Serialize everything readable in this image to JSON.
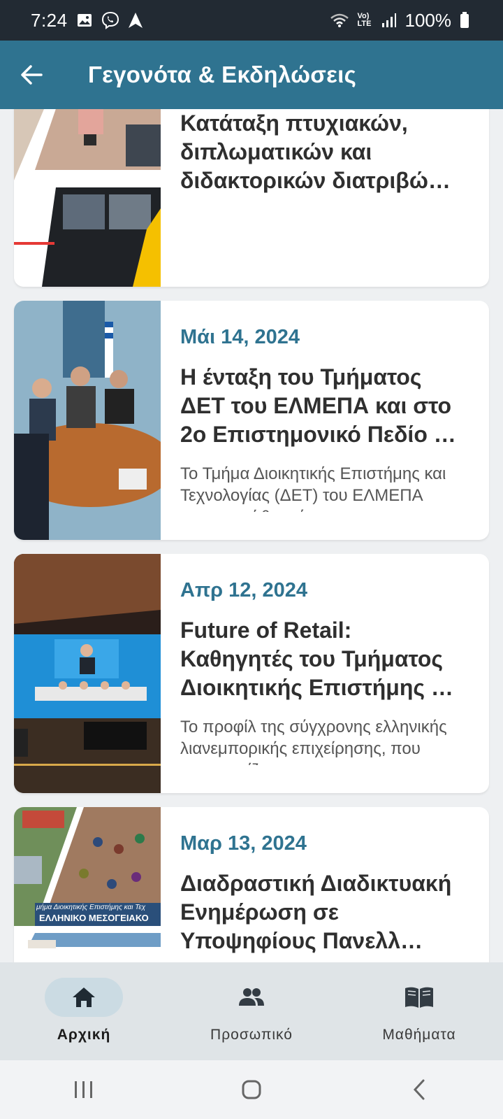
{
  "status_bar": {
    "time": "7:24",
    "battery": "100%",
    "network_label": "Vo) LTE",
    "icons": [
      "image-icon",
      "viber-icon",
      "navigation-icon",
      "wifi-icon",
      "lte-icon",
      "signal-icon",
      "battery-icon"
    ]
  },
  "app_bar": {
    "title": "Γεγονότα & Εκδηλώσεις",
    "back_icon": "arrow-back-icon"
  },
  "news": [
    {
      "date": "",
      "title": "Κατάταξη πτυχιακών, διπλωματικών και διδακτορικών διατριβώ…",
      "excerpt": ""
    },
    {
      "date": "Μάι 14, 2024",
      "title": "Η ένταξη του Τμήματος ΔΕΤ του ΕΛΜΕΠΑ και στο 2ο Επιστημονικό Πεδίο …",
      "excerpt": "Το Τμήμα Διοικητικής Επιστήμης και Τεχνολογίας (ΔΕΤ) του ΕΛΜΕΠΑ ευχαριστεί θερμά τον"
    },
    {
      "date": "Απρ 12, 2024",
      "title": "Future of Retail: Καθηγητές του Τμήματος Διοικητικής Επιστήμης …",
      "excerpt": "Το προφίλ της σύγχρονης ελληνικής λιανεμπορικής επιχείρησης, που αναγνωρίζει τ"
    },
    {
      "date": "Μαρ 13, 2024",
      "title": "Διαδραστική Διαδικτυακή Ενημέρωση σε Υποψηφίους Πανελλ…",
      "excerpt": ""
    }
  ],
  "image_overlay": {
    "line1": "μήμα Διοικητικής Επιστήμης και Τεχ",
    "line2": "ΕΛΛΗΝΙΚΟ ΜΕΣΟΓΕΙΑΚΟ"
  },
  "bottom_nav": {
    "items": [
      {
        "label": "Αρχική",
        "icon": "home-icon",
        "active": true
      },
      {
        "label": "Προσωπικό",
        "icon": "people-icon",
        "active": false
      },
      {
        "label": "Μαθήματα",
        "icon": "book-icon",
        "active": false
      }
    ]
  },
  "colors": {
    "app_bar": "#2f7390",
    "status_bar": "#222a33",
    "date": "#2f7390",
    "background": "#eef0f2",
    "nav_background": "#dfe4e7",
    "nav_active_pill": "#cbdbe3"
  }
}
